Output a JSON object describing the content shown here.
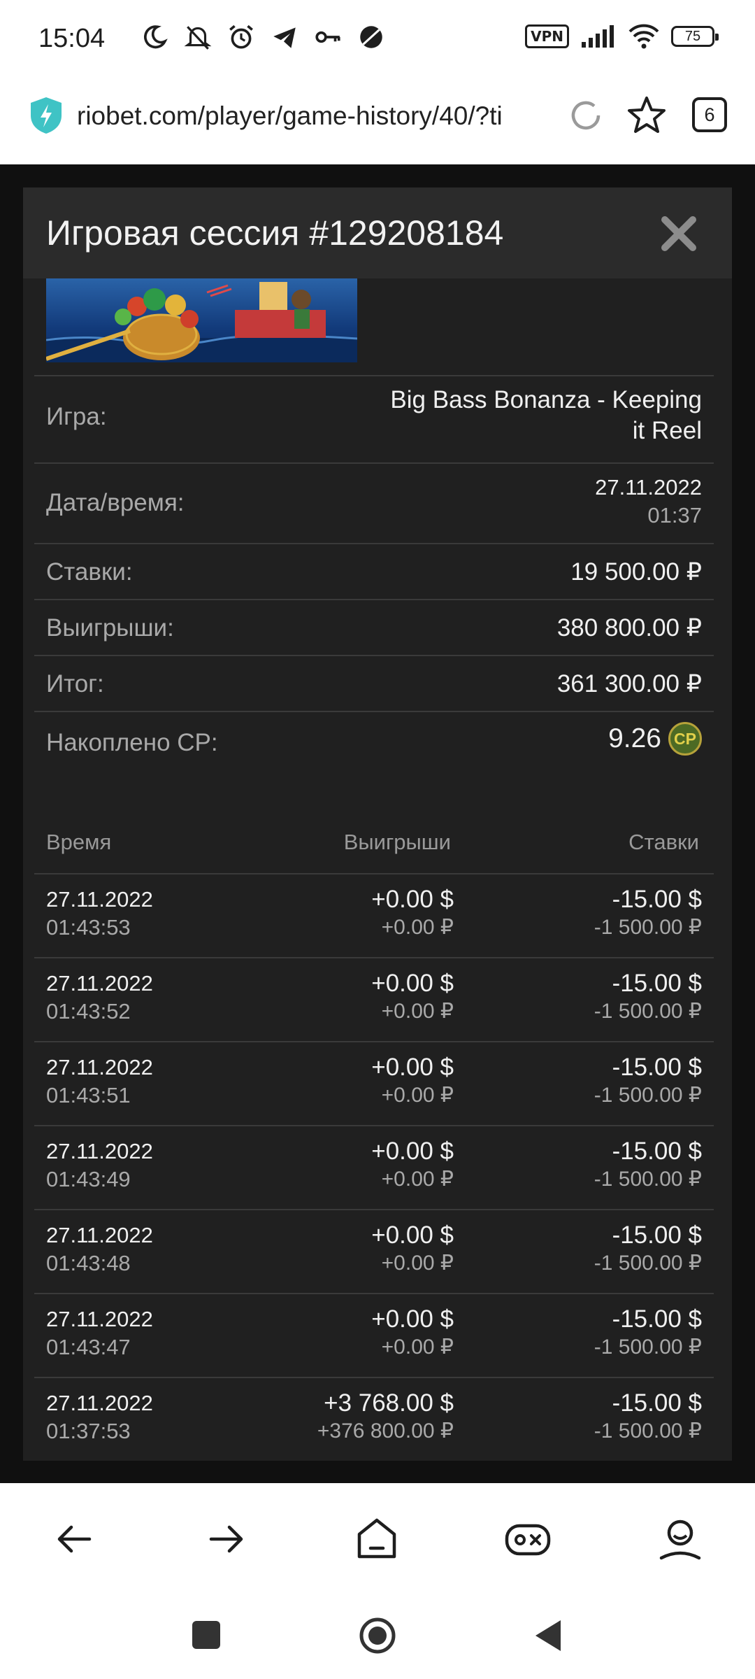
{
  "status_bar": {
    "time": "15:04",
    "vpn": "VPN",
    "battery": "75",
    "icons": [
      "moon-icon",
      "silent-icon",
      "alarm-icon",
      "telegram-icon",
      "key-icon",
      "blocked-icon",
      "signal-icon",
      "wifi-icon"
    ]
  },
  "browser": {
    "url": "riobet.com/player/game-history/40/?ti",
    "tab_count": "6"
  },
  "modal": {
    "title": "Игровая сессия #129208184",
    "details": [
      {
        "label": "Игра:",
        "value": "Big Bass Bonanza - Keeping",
        "value2": "it Reel"
      },
      {
        "label": "Дата/время:",
        "value": "27.11.2022",
        "value2": "01:37"
      },
      {
        "label": "Ставки:",
        "value": "19 500.00 ₽"
      },
      {
        "label": "Выигрыши:",
        "value": "380 800.00 ₽"
      },
      {
        "label": "Итог:",
        "value": "361 300.00 ₽"
      },
      {
        "label": "Накоплено CP:",
        "value": "9.26",
        "badge": "CP"
      }
    ],
    "table": {
      "headers": [
        "Время",
        "Выигрыши",
        "Ставки"
      ],
      "rows": [
        {
          "date": "27.11.2022",
          "time": "01:43:53",
          "win_usd": "+0.00 $",
          "win_rub": "+0.00 ₽",
          "bet_usd": "-15.00 $",
          "bet_rub": "-1 500.00 ₽"
        },
        {
          "date": "27.11.2022",
          "time": "01:43:52",
          "win_usd": "+0.00 $",
          "win_rub": "+0.00 ₽",
          "bet_usd": "-15.00 $",
          "bet_rub": "-1 500.00 ₽"
        },
        {
          "date": "27.11.2022",
          "time": "01:43:51",
          "win_usd": "+0.00 $",
          "win_rub": "+0.00 ₽",
          "bet_usd": "-15.00 $",
          "bet_rub": "-1 500.00 ₽"
        },
        {
          "date": "27.11.2022",
          "time": "01:43:49",
          "win_usd": "+0.00 $",
          "win_rub": "+0.00 ₽",
          "bet_usd": "-15.00 $",
          "bet_rub": "-1 500.00 ₽"
        },
        {
          "date": "27.11.2022",
          "time": "01:43:48",
          "win_usd": "+0.00 $",
          "win_rub": "+0.00 ₽",
          "bet_usd": "-15.00 $",
          "bet_rub": "-1 500.00 ₽"
        },
        {
          "date": "27.11.2022",
          "time": "01:43:47",
          "win_usd": "+0.00 $",
          "win_rub": "+0.00 ₽",
          "bet_usd": "-15.00 $",
          "bet_rub": "-1 500.00 ₽"
        },
        {
          "date": "27.11.2022",
          "time": "01:37:53",
          "win_usd": "+3 768.00 $",
          "win_rub": "+376 800.00 ₽",
          "bet_usd": "-15.00 $",
          "bet_rub": "-1 500.00 ₽"
        }
      ]
    }
  },
  "colors": {
    "modal_bg": "#202020",
    "header_bg": "#2b2b2b",
    "text": "#f0f0f0",
    "muted": "#a9a9a9",
    "cp_badge": "#4c6a24"
  },
  "browser_nav": [
    "back-icon",
    "forward-icon",
    "home-icon",
    "game-icon",
    "profile-icon"
  ]
}
